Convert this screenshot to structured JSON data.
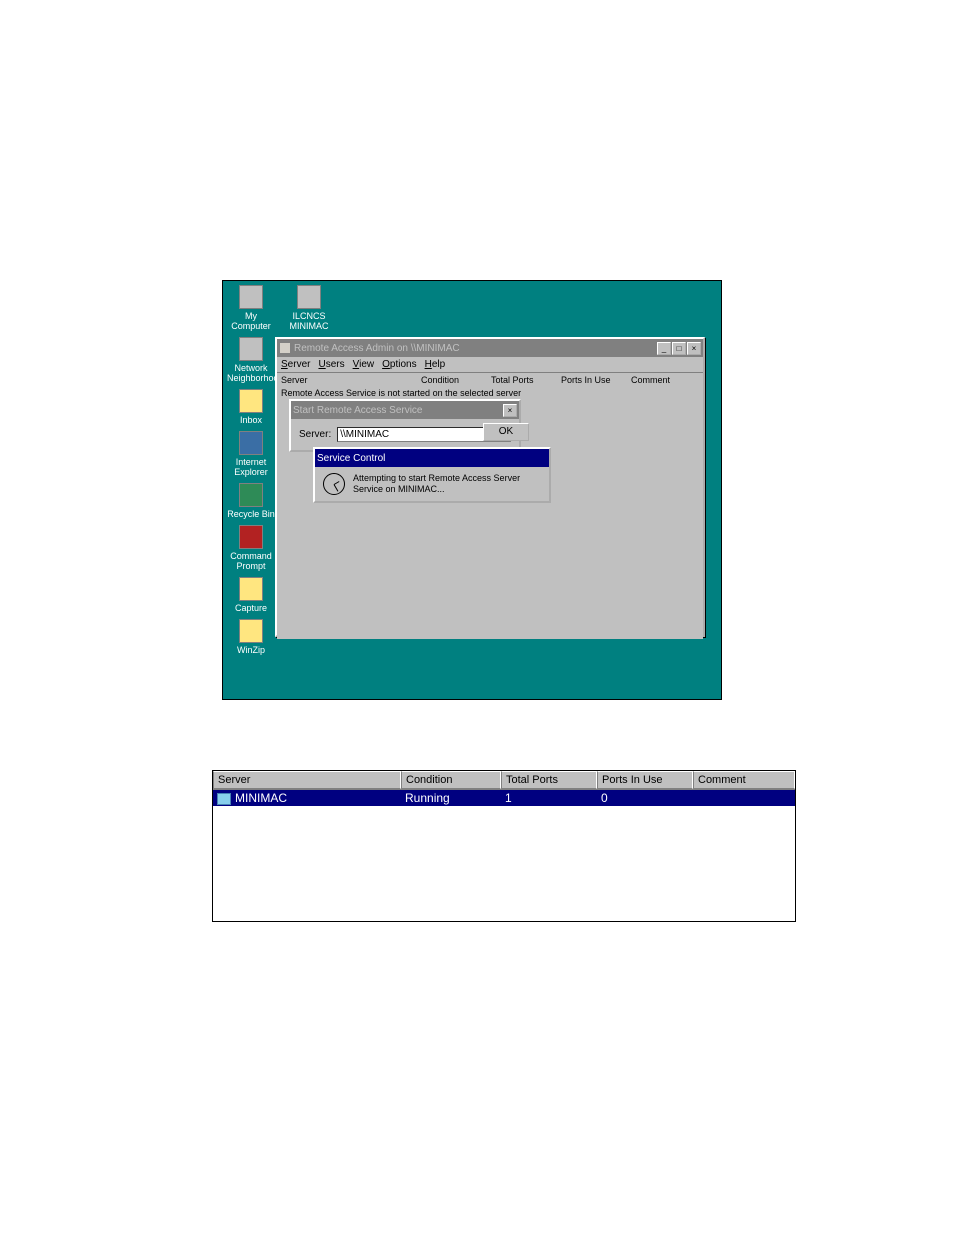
{
  "desktop": {
    "icons": [
      {
        "label": "My Computer"
      },
      {
        "label": "Network Neighborhood"
      },
      {
        "label": "Inbox"
      },
      {
        "label": "Internet Explorer"
      },
      {
        "label": "Recycle Bin"
      },
      {
        "label": "Command Prompt"
      },
      {
        "label": "Capture"
      },
      {
        "label": "WinZip"
      }
    ],
    "icon_col2": {
      "label": "ILCNCS MINIMAC"
    }
  },
  "raa_window": {
    "title": "Remote Access Admin on \\\\MINIMAC",
    "menus": [
      "Server",
      "Users",
      "View",
      "Options",
      "Help"
    ],
    "headers": {
      "server": "Server",
      "condition": "Condition",
      "total_ports": "Total Ports",
      "ports_in_use": "Ports In Use",
      "comment": "Comment"
    },
    "status_line": "Remote Access Service is not started on the selected server"
  },
  "start_dialog": {
    "title": "Start Remote Access Service",
    "server_label": "Server:",
    "server_value": "\\\\MINIMAC",
    "ok_label": "OK"
  },
  "svc_dialog": {
    "title": "Service Control",
    "message": "Attempting to start Remote Access Server Service on MINIMAC..."
  },
  "server_table": {
    "headers": {
      "server": "Server",
      "condition": "Condition",
      "total_ports": "Total Ports",
      "ports_in_use": "Ports In Use",
      "comment": "Comment"
    },
    "rows": [
      {
        "server": "MINIMAC",
        "condition": "Running",
        "total_ports": "1",
        "ports_in_use": "0",
        "comment": ""
      }
    ]
  }
}
